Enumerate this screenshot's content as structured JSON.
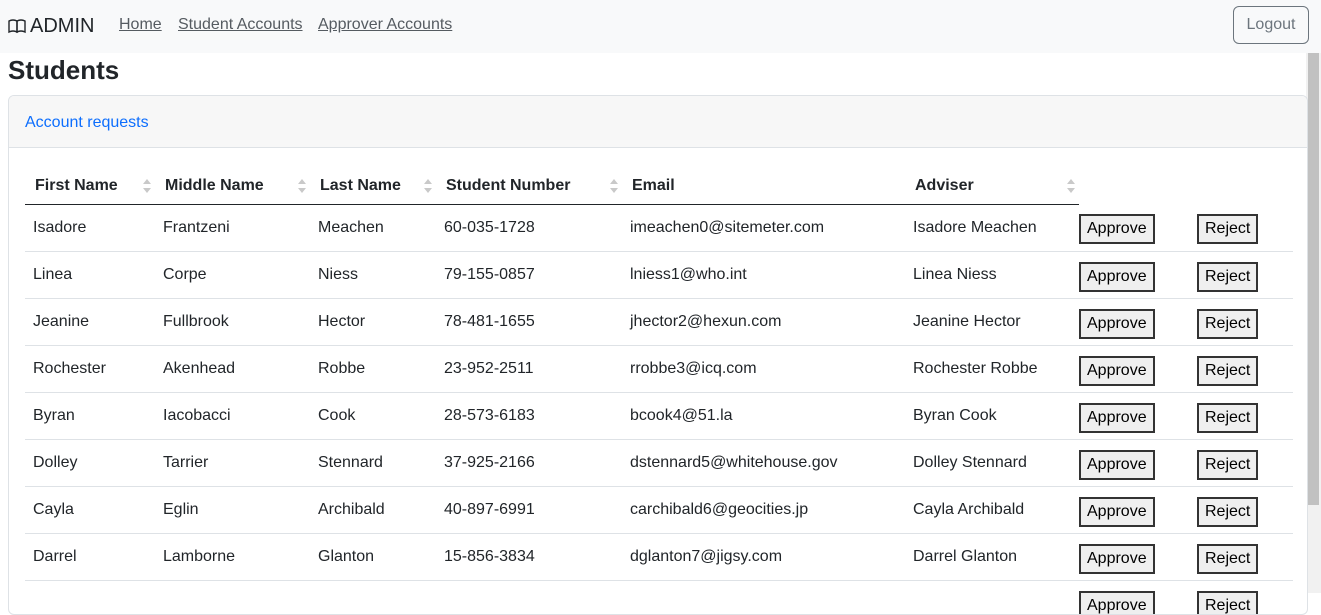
{
  "navbar": {
    "brand": "ADMIN",
    "brand_icon": "book-icon",
    "links": [
      "Home",
      "Student Accounts",
      "Approver Accounts"
    ],
    "logout_label": "Logout"
  },
  "page": {
    "title": "Students",
    "card_header_link": "Account requests"
  },
  "table": {
    "headers": [
      "First Name",
      "Middle Name",
      "Last Name",
      "Student Number",
      "Email",
      "Adviser"
    ],
    "approve_label": "Approve",
    "reject_label": "Reject",
    "rows": [
      [
        "Isadore",
        "Frantzeni",
        "Meachen",
        "60-035-1728",
        "imeachen0@sitemeter.com",
        "Isadore Meachen"
      ],
      [
        "Linea",
        "Corpe",
        "Niess",
        "79-155-0857",
        "lniess1@who.int",
        "Linea Niess"
      ],
      [
        "Jeanine",
        "Fullbrook",
        "Hector",
        "78-481-1655",
        "jhector2@hexun.com",
        "Jeanine Hector"
      ],
      [
        "Rochester",
        "Akenhead",
        "Robbe",
        "23-952-2511",
        "rrobbe3@icq.com",
        "Rochester Robbe"
      ],
      [
        "Byran",
        "Iacobacci",
        "Cook",
        "28-573-6183",
        "bcook4@51.la",
        "Byran Cook"
      ],
      [
        "Dolley",
        "Tarrier",
        "Stennard",
        "37-925-2166",
        "dstennard5@whitehouse.gov",
        "Dolley Stennard"
      ],
      [
        "Cayla",
        "Eglin",
        "Archibald",
        "40-897-6991",
        "carchibald6@geocities.jp",
        "Cayla Archibald"
      ],
      [
        "Darrel",
        "Lamborne",
        "Glanton",
        "15-856-3834",
        "dglanton7@jigsy.com",
        "Darrel Glanton"
      ],
      [
        "",
        "",
        "",
        "",
        "",
        ""
      ]
    ]
  }
}
